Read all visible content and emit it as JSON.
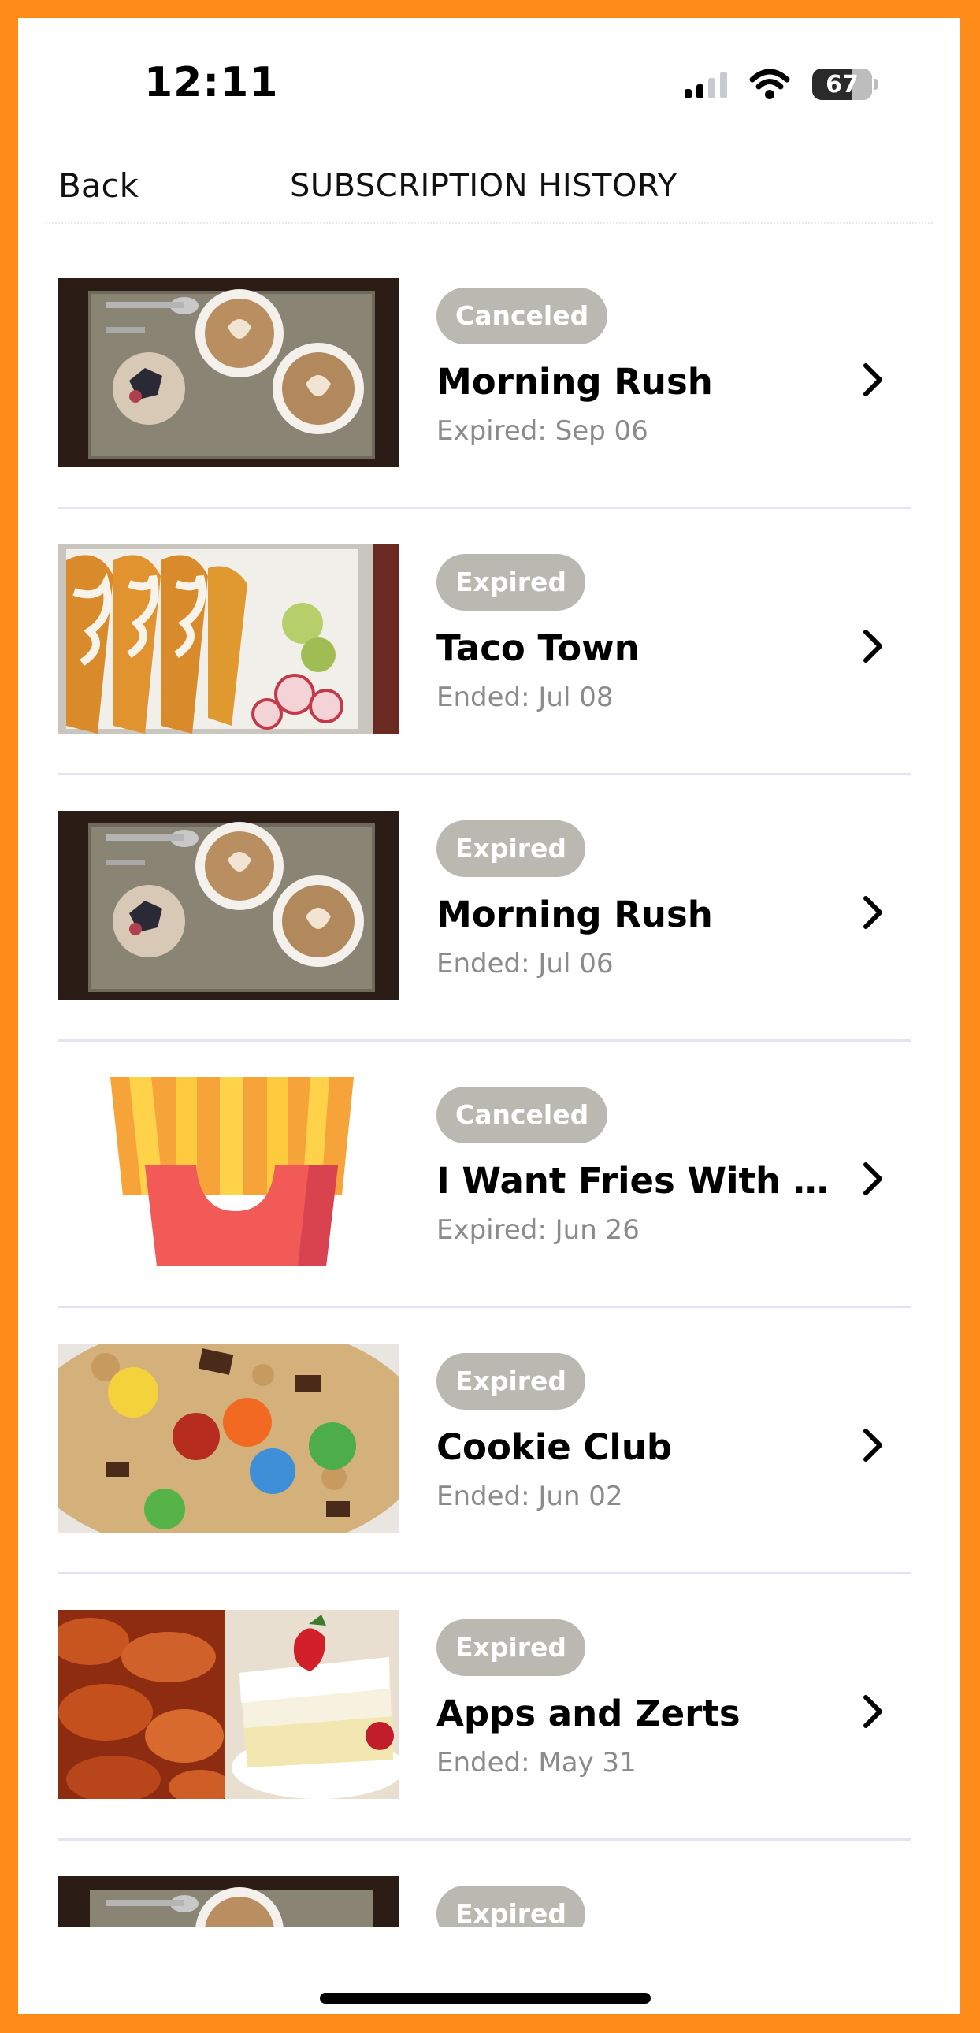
{
  "status_bar": {
    "time": "12:11",
    "battery": "67"
  },
  "nav": {
    "back_label": "Back",
    "title": "SUBSCRIPTION HISTORY"
  },
  "items": [
    {
      "badge": "Canceled",
      "title": "Morning Rush",
      "subtitle": "Expired: Sep 06",
      "image": "coffee-image"
    },
    {
      "badge": "Expired",
      "title": "Taco Town",
      "subtitle": "Ended: Jul 08",
      "image": "tacos-image"
    },
    {
      "badge": "Expired",
      "title": "Morning Rush",
      "subtitle": "Ended: Jul 06",
      "image": "coffee-image"
    },
    {
      "badge": "Canceled",
      "title": "I Want Fries With That",
      "subtitle": "Expired: Jun 26",
      "image": "fries-image"
    },
    {
      "badge": "Expired",
      "title": "Cookie Club",
      "subtitle": "Ended: Jun 02",
      "image": "cookie-image"
    },
    {
      "badge": "Expired",
      "title": "Apps and Zerts",
      "subtitle": "Ended: May 31",
      "image": "wings-cake-image"
    },
    {
      "badge": "Expired",
      "title": "",
      "subtitle": "",
      "image": "coffee-image"
    }
  ],
  "icons": {
    "row_chevron": "chevron-right-icon",
    "signal": "cellular-signal-icon",
    "wifi": "wifi-icon",
    "battery": "battery-icon"
  },
  "colors": {
    "frame": "#ff8c1a",
    "badge_bg": "#b9b9b1",
    "subtitle": "#8b8b8b",
    "divider": "#e3e3f2"
  }
}
